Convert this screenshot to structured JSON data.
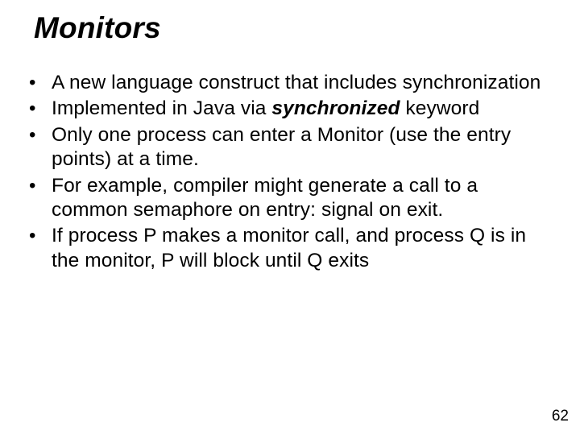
{
  "slide": {
    "title": "Monitors",
    "bullets": [
      {
        "pre": "A new language construct that includes synchronization"
      },
      {
        "pre": "Implemented in Java via ",
        "em": "synchronized",
        "post": " keyword"
      },
      {
        "pre": "Only one process can enter a Monitor (use the entry points) at a time."
      },
      {
        "pre": "For example, compiler might generate a call to a common semaphore on entry: signal on exit."
      },
      {
        "pre": "If process P makes a monitor call, and process Q is in the monitor, P will block until Q exits"
      }
    ],
    "page_number": "62"
  }
}
